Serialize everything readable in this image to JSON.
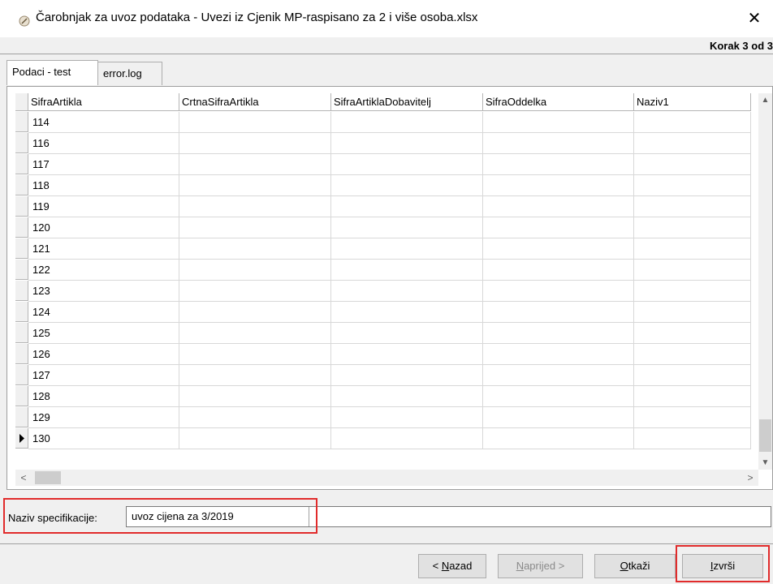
{
  "window": {
    "title": "Čarobnjak za uvoz podataka - Uvezi iz Cjenik MP-raspisano za 2 i više osoba.xlsx",
    "close_glyph": "✕"
  },
  "step_text": "Korak 3 od 3",
  "tabs": [
    {
      "label": "Podaci - test",
      "active": true
    },
    {
      "label": "error.log",
      "active": false
    }
  ],
  "grid": {
    "columns": [
      "SifraArtikla",
      "CrtnaSifraArtikla",
      "SifraArtiklaDobavitelj",
      "SifraOddelka",
      "Naziv1"
    ],
    "rows": [
      "114",
      "116",
      "117",
      "118",
      "119",
      "120",
      "121",
      "122",
      "123",
      "124",
      "125",
      "126",
      "127",
      "128",
      "129",
      "130"
    ],
    "current_row": "130"
  },
  "spec": {
    "label": "Naziv specifikacije:",
    "value": "uvoz cijena za 3/2019"
  },
  "buttons": {
    "back": {
      "prefix": "< ",
      "key": "N",
      "rest": "azad"
    },
    "next": {
      "key": "N",
      "rest": "aprijed >"
    },
    "cancel": {
      "key": "O",
      "rest": "tkaži"
    },
    "run": {
      "key": "I",
      "rest": "zvrši"
    }
  },
  "highlight_color": "#e12b2b"
}
